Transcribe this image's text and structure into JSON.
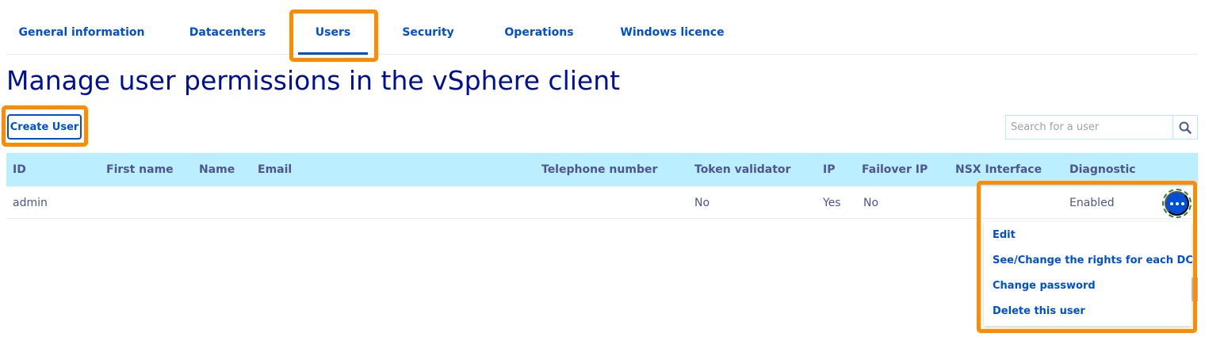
{
  "tabs": [
    {
      "label": "General information"
    },
    {
      "label": "Datacenters"
    },
    {
      "label": "Users",
      "active": true
    },
    {
      "label": "Security"
    },
    {
      "label": "Operations"
    },
    {
      "label": "Windows licence"
    }
  ],
  "page": {
    "title": "Manage user permissions in the vSphere client"
  },
  "toolbar": {
    "create_user_label": "Create User"
  },
  "search": {
    "placeholder": "Search for a user",
    "icon": "search-icon"
  },
  "table": {
    "columns": [
      "ID",
      "First name",
      "Name",
      "Email",
      "Telephone number",
      "Token validator",
      "IP",
      "Failover IP",
      "NSX Interface",
      "Diagnostic"
    ],
    "rows": [
      {
        "id": "admin",
        "first_name": "",
        "name": "",
        "email": "",
        "telephone": "",
        "token_validator": "No",
        "ip": "Yes",
        "failover_ip": "No",
        "nsx_interface": "",
        "diagnostic": "Enabled"
      }
    ]
  },
  "row_actions": {
    "icon": "more-dots-icon",
    "items": [
      "Edit",
      "See/Change the rights for each DC",
      "Change password",
      "Delete this user"
    ]
  },
  "colors": {
    "accent": "#0050d7",
    "header_bg": "#bbefff",
    "highlight": "#ff8c00",
    "title": "#000e9c"
  }
}
